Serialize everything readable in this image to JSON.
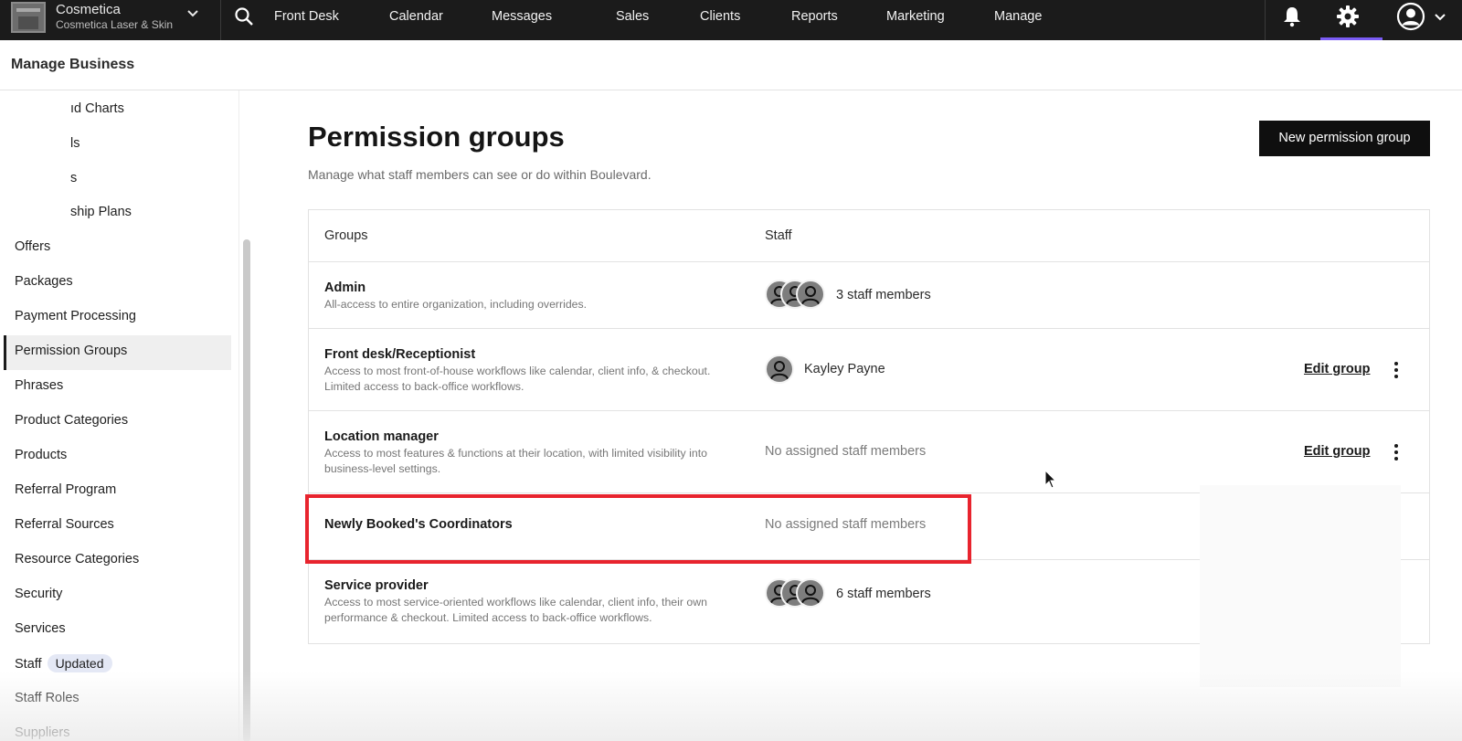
{
  "topbar": {
    "business_name": "Cosmetica",
    "business_location": "Cosmetica Laser & Skin",
    "nav": [
      "Front Desk",
      "Calendar",
      "Messages",
      "Sales",
      "Clients",
      "Reports",
      "Marketing",
      "Manage"
    ],
    "icons": [
      "business-logo",
      "chevron-down-icon",
      "search-icon",
      "bell-icon",
      "gear-icon",
      "account-icon"
    ],
    "accent_color": "#7b5cf5"
  },
  "subheader": {
    "title": "Manage Business"
  },
  "sidebar": {
    "items": [
      {
        "label": "ıd Charts"
      },
      {
        "label": "ls"
      },
      {
        "label": "s"
      },
      {
        "label": "ship Plans"
      },
      {
        "label": "Offers"
      },
      {
        "label": "Packages"
      },
      {
        "label": "Payment Processing"
      },
      {
        "label": "Permission Groups"
      },
      {
        "label": "Phrases"
      },
      {
        "label": "Product Categories"
      },
      {
        "label": "Products"
      },
      {
        "label": "Referral Program"
      },
      {
        "label": "Referral Sources"
      },
      {
        "label": "Resource Categories"
      },
      {
        "label": "Security"
      },
      {
        "label": "Services"
      },
      {
        "label": "Staff",
        "badge": "Updated"
      },
      {
        "label": "Staff Roles"
      },
      {
        "label": "Suppliers"
      }
    ],
    "active": "Permission Groups"
  },
  "main": {
    "title": "Permission groups",
    "subtitle": "Manage what staff members can see or do within Boulevard.",
    "new_button": "New permission group",
    "table": {
      "headers": [
        "Groups",
        "Staff"
      ],
      "rows": [
        {
          "name": "Admin",
          "description": "All-access to entire organization, including overrides.",
          "staff": "3 staff members",
          "avatars": 3
        },
        {
          "name": "Front desk/Receptionist",
          "description": "Access to most front-of-house workflows like calendar, client info, & checkout. Limited access to back-office workflows.",
          "staff": "Kayley Payne",
          "avatars": 1,
          "edit": "Edit group"
        },
        {
          "name": "Location manager",
          "description": "Access to most features & functions at their location, with limited visibility into business-level settings.",
          "staff": "No assigned staff members",
          "avatars": 0,
          "edit": "Edit group"
        },
        {
          "name": "Newly Booked's Coordinators",
          "description": "",
          "staff": "No assigned staff members",
          "avatars": 0
        },
        {
          "name": "Service provider",
          "description": "Access to most service-oriented workflows like calendar, client info, their own performance & checkout. Limited access to back-office workflows.",
          "staff": "6 staff members",
          "avatars": 3
        }
      ]
    },
    "highlight_color": "#e8242e"
  }
}
